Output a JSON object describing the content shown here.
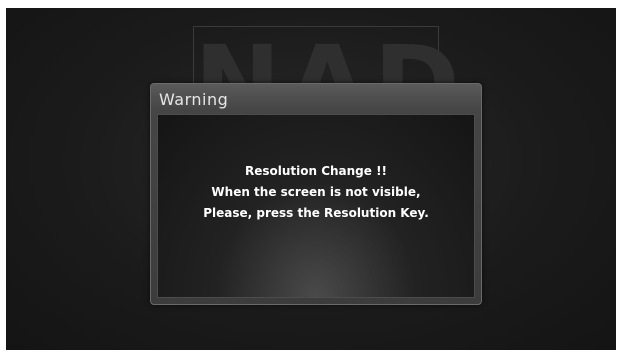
{
  "logo": {
    "text": "NAD"
  },
  "dialog": {
    "title": "Warning",
    "lines": [
      "Resolution Change !!",
      "When the screen is not visible,",
      "Please, press the Resolution Key."
    ]
  }
}
